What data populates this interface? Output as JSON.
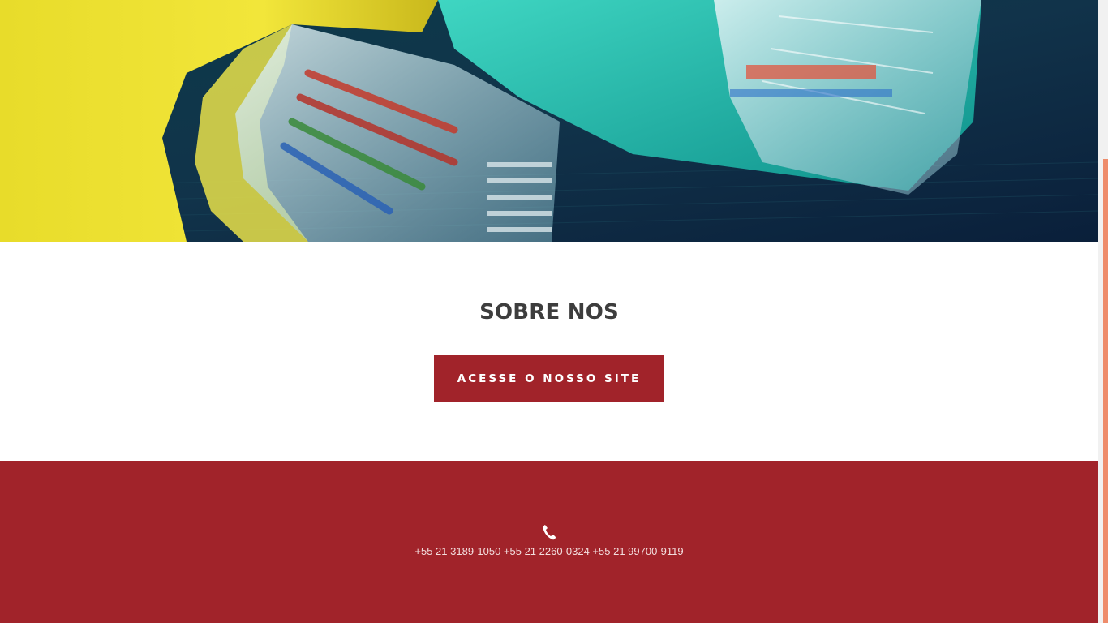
{
  "hero": {
    "image_description_icon": "ethernet-cables-photo"
  },
  "about": {
    "title": "SOBRE NOS",
    "cta_label": "ACESSE O NOSSO SITE"
  },
  "footer": {
    "phone_icon": "phone-icon",
    "phones": "+55 21 3189-1050 +55 21 2260-0324 +55 21 99700-9119"
  },
  "colors": {
    "brand_red": "#a1232a",
    "title_gray": "#3d3d3d",
    "scroll_accent": "#ee8c6b"
  }
}
